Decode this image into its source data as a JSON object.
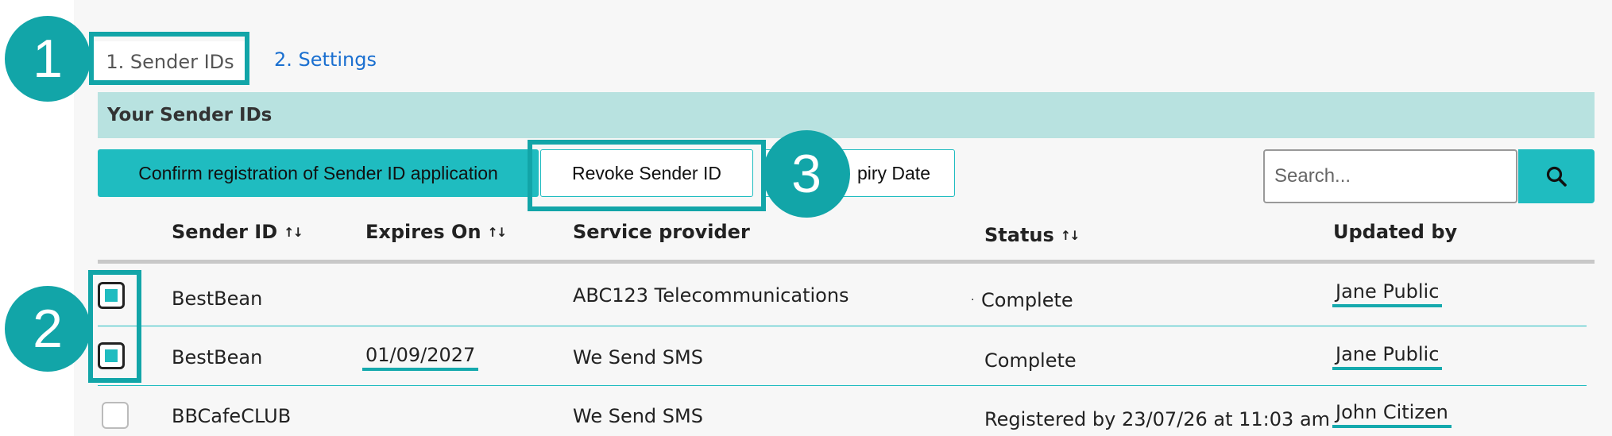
{
  "tabs": [
    {
      "label": "1. Sender IDs"
    },
    {
      "label": "2. Settings"
    }
  ],
  "section_title": "Your Sender IDs",
  "actions": {
    "confirm_label": "Confirm registration of Sender ID application",
    "revoke_label": "Revoke Sender ID",
    "expiry_label": "piry Date"
  },
  "search": {
    "placeholder": "Search...",
    "button_icon": "search-icon"
  },
  "table": {
    "columns": [
      {
        "label": "Sender ID",
        "sort": "↑↓"
      },
      {
        "label": "Expires On",
        "sort": "↑↓"
      },
      {
        "label": "Service provider"
      },
      {
        "label": "Status",
        "sort": "↑↓"
      },
      {
        "label": "Updated by"
      }
    ],
    "rows": [
      {
        "checked": true,
        "sender_id": "BestBean",
        "expires_on": "",
        "provider": "ABC123 Telecommunications",
        "status": "Complete",
        "updated_by": "Jane Public"
      },
      {
        "checked": true,
        "sender_id": "BestBean",
        "expires_on": "01/09/2027",
        "provider": "We Send SMS",
        "status": "Complete",
        "updated_by": "Jane Public"
      },
      {
        "checked": false,
        "sender_id": "BBCafeCLUB",
        "expires_on": "",
        "provider": "We Send SMS",
        "status": "Registered by 23/07/26 at 11:03 am",
        "updated_by": "John Citizen"
      }
    ]
  },
  "callouts": [
    "1",
    "2",
    "3"
  ],
  "colors": {
    "accent": "#1fbcc0",
    "callout": "#12a5a8",
    "section_bar": "#b8e2e0",
    "link": "#1a6fd0"
  }
}
